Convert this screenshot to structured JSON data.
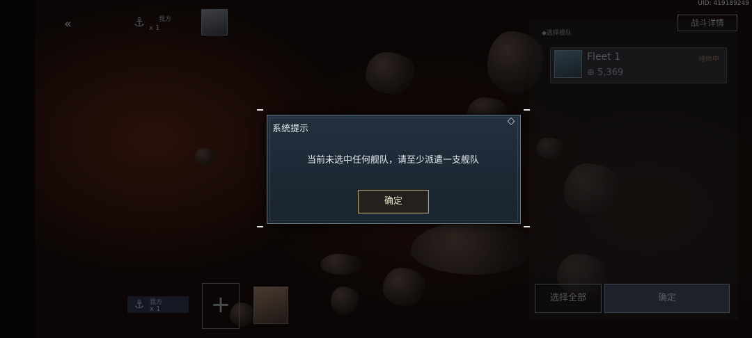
{
  "uid": "UID: 419189249",
  "header": {
    "back_icon": "double-chevron-left-icon",
    "side_label": "我方",
    "fleet_count": "x 1",
    "battle_details": "战斗详情"
  },
  "right_panel": {
    "title": "◆选择舰队",
    "fleet": {
      "name": "Fleet 1",
      "power": "5,369",
      "status": "待命中"
    },
    "select_all": "选择全部",
    "confirm": "确定"
  },
  "bottom": {
    "side_label": "我方",
    "fleet_count": "x 1",
    "add": "+"
  },
  "dialog": {
    "title": "系统提示",
    "message": "当前未选中任何舰队，请至少派遣一支舰队",
    "confirm": "确定",
    "corner_icon": "diamond-icon"
  }
}
